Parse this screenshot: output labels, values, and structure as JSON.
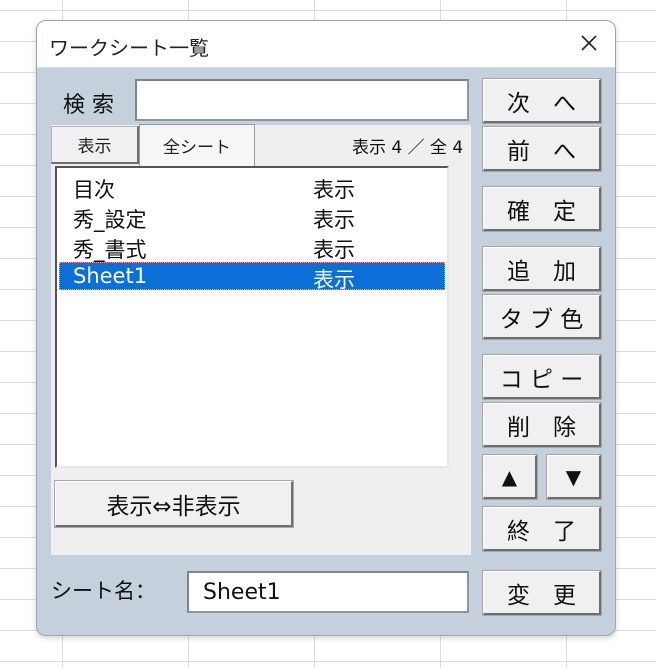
{
  "dialog": {
    "title": "ワークシート一覧",
    "close_symbol": "×"
  },
  "search": {
    "label": "検 索",
    "value": ""
  },
  "tabs": [
    {
      "label": "表示",
      "state": "pressed"
    },
    {
      "label": "全シート",
      "state": "selected"
    }
  ],
  "count_text": "表示 4 ／ 全 4",
  "sheet_list": {
    "rows": [
      {
        "name": "目次",
        "status": "表示",
        "selected": false
      },
      {
        "name": "秀_設定",
        "status": "表示",
        "selected": false
      },
      {
        "name": "秀_書式",
        "status": "表示",
        "selected": false
      },
      {
        "name": "Sheet1",
        "status": "表示",
        "selected": true
      }
    ]
  },
  "toggle_button": "表示⇔非表示",
  "sheet_name": {
    "label": "シート名：",
    "value": "Sheet1"
  },
  "right_buttons": {
    "next": "次　へ",
    "prev": "前　へ",
    "confirm": "確　定",
    "add": "追　加",
    "tab_color": "タ ブ 色",
    "copy": "コ ピ ー",
    "delete": "削　除",
    "up": "▲",
    "down": "▼",
    "exit": "終　了",
    "rename": "変　更"
  },
  "colors": {
    "dialog_bg": "#c4d0db",
    "selection": "#0b6fd8",
    "button_face": "#f0f0f0"
  }
}
